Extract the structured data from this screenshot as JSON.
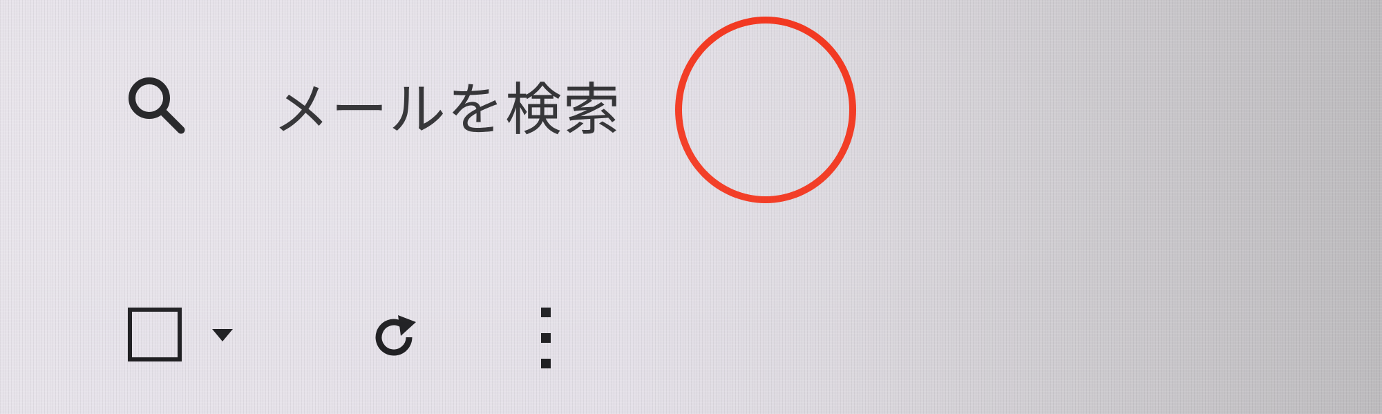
{
  "search": {
    "icon": "search-icon",
    "placeholder": "メールを検索"
  },
  "annotation": {
    "shape": "circle",
    "color": "#f2361e"
  },
  "toolbar": {
    "select_checkbox_icon": "checkbox-icon",
    "select_dropdown_icon": "caret-down-icon",
    "refresh_icon": "refresh-icon",
    "more_icon": "more-vertical-icon"
  },
  "colors": {
    "text": "#2b2b2e",
    "icon": "#1f1f22",
    "annotation": "#f2361e"
  }
}
